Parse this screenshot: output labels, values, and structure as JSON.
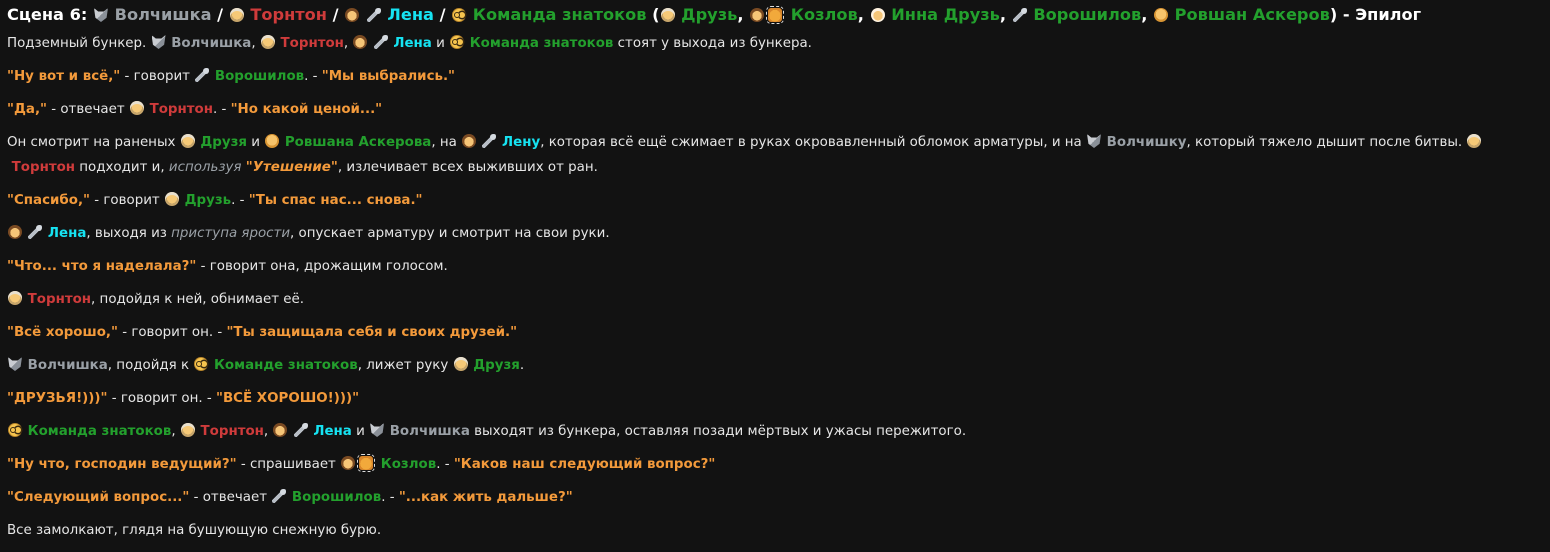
{
  "colors": {
    "background": "#121212",
    "text": "#e6e6e6",
    "wolf_grey": "#9aa0a6",
    "thornton_red": "#cf3b3b",
    "lena_cyan": "#16e3f2",
    "team_green": "#23a02d",
    "quote_orange": "#f39a3b"
  },
  "title": {
    "segments": [
      {
        "text": "Сцена 6: ",
        "style": "titlecolor"
      },
      {
        "icon": "wolf-icon"
      },
      {
        "text": " Волчишка",
        "style": "grey"
      },
      {
        "text": " / ",
        "style": "titlecolor"
      },
      {
        "icon": "old-man-face-icon"
      },
      {
        "text": " Торнтон",
        "style": "red"
      },
      {
        "text": " / ",
        "style": "titlecolor"
      },
      {
        "icon": "boy-face-icon"
      },
      {
        "text": " ",
        "style": "plain"
      },
      {
        "icon": "microphone-icon"
      },
      {
        "text": " Лена",
        "style": "cyan"
      },
      {
        "text": " / ",
        "style": "titlecolor"
      },
      {
        "icon": "nerd-face-icon"
      },
      {
        "text": " Команда знатоков",
        "style": "green"
      },
      {
        "text": " (",
        "style": "titlecolor"
      },
      {
        "icon": "old-man-face-icon"
      },
      {
        "text": " Друзь",
        "style": "green"
      },
      {
        "text": ", ",
        "style": "titlecolor"
      },
      {
        "icon": "boy-face-icon"
      },
      {
        "icon": "raised-hand-icon"
      },
      {
        "text": " Козлов",
        "style": "green"
      },
      {
        "text": ", ",
        "style": "titlecolor"
      },
      {
        "icon": "old-woman-face-icon"
      },
      {
        "text": " Инна Друзь",
        "style": "green"
      },
      {
        "text": ", ",
        "style": "titlecolor"
      },
      {
        "icon": "microphone-icon"
      },
      {
        "text": " Ворошилов",
        "style": "green"
      },
      {
        "text": ", ",
        "style": "titlecolor"
      },
      {
        "icon": "man-face-icon"
      },
      {
        "text": " Ровшан Аскеров",
        "style": "green"
      },
      {
        "text": ") - Эпилог",
        "style": "titlecolor"
      }
    ]
  },
  "paragraphs": [
    {
      "segments": [
        {
          "text": "Подземный бункер. ",
          "style": "plain"
        },
        {
          "icon": "wolf-icon"
        },
        {
          "text": " Волчишка",
          "style": "grey"
        },
        {
          "text": ", ",
          "style": "plain"
        },
        {
          "icon": "old-man-face-icon"
        },
        {
          "text": " Торнтон",
          "style": "red"
        },
        {
          "text": ", ",
          "style": "plain"
        },
        {
          "icon": "boy-face-icon"
        },
        {
          "text": " ",
          "style": "plain"
        },
        {
          "icon": "microphone-icon"
        },
        {
          "text": " Лена",
          "style": "cyan"
        },
        {
          "text": " и ",
          "style": "plain"
        },
        {
          "icon": "nerd-face-icon"
        },
        {
          "text": " Команда знатоков",
          "style": "green"
        },
        {
          "text": " стоят у выхода из бункера.",
          "style": "plain"
        }
      ]
    },
    {
      "segments": [
        {
          "text": "\"Ну вот и всё,\"",
          "style": "orange"
        },
        {
          "text": " - говорит ",
          "style": "plain"
        },
        {
          "icon": "microphone-icon"
        },
        {
          "text": " Ворошилов",
          "style": "green"
        },
        {
          "text": ". - ",
          "style": "plain"
        },
        {
          "text": "\"Мы выбрались.\"",
          "style": "orange"
        }
      ]
    },
    {
      "segments": [
        {
          "text": "\"Да,\"",
          "style": "orange"
        },
        {
          "text": " - отвечает ",
          "style": "plain"
        },
        {
          "icon": "old-man-face-icon"
        },
        {
          "text": " Торнтон",
          "style": "red"
        },
        {
          "text": ". - ",
          "style": "plain"
        },
        {
          "text": "\"Но какой ценой...\"",
          "style": "orange"
        }
      ]
    },
    {
      "multi": true,
      "segments": [
        {
          "text": "Он смотрит на раненых ",
          "style": "plain"
        },
        {
          "icon": "old-man-face-icon"
        },
        {
          "text": " Друзя",
          "style": "green"
        },
        {
          "text": " и ",
          "style": "plain"
        },
        {
          "icon": "man-face-icon"
        },
        {
          "text": " Ровшана Аскерова",
          "style": "green"
        },
        {
          "text": ", на ",
          "style": "plain"
        },
        {
          "icon": "boy-face-icon"
        },
        {
          "text": " ",
          "style": "plain"
        },
        {
          "icon": "microphone-icon"
        },
        {
          "text": " Лену",
          "style": "cyan"
        },
        {
          "text": ", которая всё ещё сжимает в руках окровавленный обломок арматуры, и на ",
          "style": "plain"
        },
        {
          "icon": "wolf-icon"
        },
        {
          "text": " Волчишку",
          "style": "grey"
        },
        {
          "text": ", который тяжело дышит после битвы. ",
          "style": "plain"
        },
        {
          "icon": "old-man-face-icon"
        },
        {
          "text": " Торнтон",
          "style": "red"
        },
        {
          "text": " подходит и, ",
          "style": "plain"
        },
        {
          "text": "используя",
          "style": "ital"
        },
        {
          "text": " ",
          "style": "plain"
        },
        {
          "text": "\"Утешение\"",
          "style": "italq"
        },
        {
          "text": ", излечивает всех выживших от ран.",
          "style": "plain"
        }
      ]
    },
    {
      "segments": [
        {
          "text": "\"Спасибо,\"",
          "style": "orange"
        },
        {
          "text": " - говорит ",
          "style": "plain"
        },
        {
          "icon": "old-man-face-icon"
        },
        {
          "text": " Друзь",
          "style": "green"
        },
        {
          "text": ". - ",
          "style": "plain"
        },
        {
          "text": "\"Ты спас нас... снова.\"",
          "style": "orange"
        }
      ]
    },
    {
      "segments": [
        {
          "icon": "boy-face-icon"
        },
        {
          "text": " ",
          "style": "plain"
        },
        {
          "icon": "microphone-icon"
        },
        {
          "text": " Лена",
          "style": "cyan"
        },
        {
          "text": ", выходя из ",
          "style": "plain"
        },
        {
          "text": "приступа ярости",
          "style": "ital"
        },
        {
          "text": ", опускает арматуру и смотрит на свои руки.",
          "style": "plain"
        }
      ]
    },
    {
      "segments": [
        {
          "text": "\"Что... что я наделала?\"",
          "style": "orange"
        },
        {
          "text": " - говорит она, дрожащим голосом.",
          "style": "plain"
        }
      ]
    },
    {
      "segments": [
        {
          "icon": "old-man-face-icon"
        },
        {
          "text": " Торнтон",
          "style": "red"
        },
        {
          "text": ", подойдя к ней, обнимает её.",
          "style": "plain"
        }
      ]
    },
    {
      "segments": [
        {
          "text": "\"Всё хорошо,\"",
          "style": "orange"
        },
        {
          "text": " - говорит он. - ",
          "style": "plain"
        },
        {
          "text": "\"Ты защищала себя и своих друзей.\"",
          "style": "orange"
        }
      ]
    },
    {
      "segments": [
        {
          "icon": "wolf-icon"
        },
        {
          "text": " Волчишка",
          "style": "grey"
        },
        {
          "text": ", подойдя к ",
          "style": "plain"
        },
        {
          "icon": "nerd-face-icon"
        },
        {
          "text": " Команде знатоков",
          "style": "green"
        },
        {
          "text": ", лижет руку ",
          "style": "plain"
        },
        {
          "icon": "old-man-face-icon"
        },
        {
          "text": " Друзя",
          "style": "green"
        },
        {
          "text": ".",
          "style": "plain"
        }
      ]
    },
    {
      "segments": [
        {
          "text": "\"ДРУЗЬЯ!)))\"",
          "style": "orange"
        },
        {
          "text": " - говорит он. - ",
          "style": "plain"
        },
        {
          "text": "\"ВСЁ ХОРОШО!)))\"",
          "style": "orange"
        }
      ]
    },
    {
      "segments": [
        {
          "icon": "nerd-face-icon"
        },
        {
          "text": " Команда знатоков",
          "style": "green"
        },
        {
          "text": ", ",
          "style": "plain"
        },
        {
          "icon": "old-man-face-icon"
        },
        {
          "text": " Торнтон",
          "style": "red"
        },
        {
          "text": ", ",
          "style": "plain"
        },
        {
          "icon": "boy-face-icon"
        },
        {
          "text": " ",
          "style": "plain"
        },
        {
          "icon": "microphone-icon"
        },
        {
          "text": " Лена",
          "style": "cyan"
        },
        {
          "text": " и ",
          "style": "plain"
        },
        {
          "icon": "wolf-icon"
        },
        {
          "text": " Волчишка",
          "style": "grey"
        },
        {
          "text": " выходят из бункера, оставляя позади мёртвых и ужасы пережитого.",
          "style": "plain"
        }
      ]
    },
    {
      "segments": [
        {
          "text": "\"Ну что, господин ведущий?\"",
          "style": "orange"
        },
        {
          "text": " - спрашивает ",
          "style": "plain"
        },
        {
          "icon": "boy-face-icon"
        },
        {
          "icon": "raised-hand-icon"
        },
        {
          "text": " Козлов",
          "style": "green"
        },
        {
          "text": ". - ",
          "style": "plain"
        },
        {
          "text": "\"Каков наш следующий вопрос?\"",
          "style": "orange"
        }
      ]
    },
    {
      "segments": [
        {
          "text": "\"Следующий вопрос...\"",
          "style": "orange"
        },
        {
          "text": " - отвечает ",
          "style": "plain"
        },
        {
          "icon": "microphone-icon"
        },
        {
          "text": " Ворошилов",
          "style": "green"
        },
        {
          "text": ". - ",
          "style": "plain"
        },
        {
          "text": "\"...как жить дальше?\"",
          "style": "orange"
        }
      ]
    },
    {
      "segments": [
        {
          "text": "Все замолкают, глядя на бушующую снежную бурю.",
          "style": "plain"
        }
      ]
    }
  ]
}
